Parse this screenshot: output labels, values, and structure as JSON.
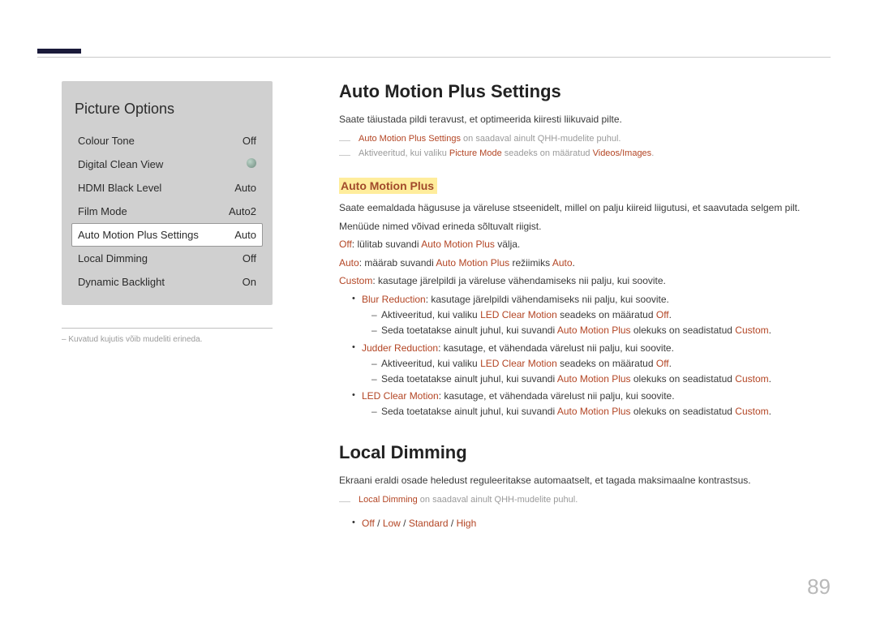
{
  "page_number": "89",
  "left": {
    "menu_title": "Picture Options",
    "rows": [
      {
        "label": "Colour Tone",
        "value": "Off"
      },
      {
        "label": "Digital Clean View",
        "value": ""
      },
      {
        "label": "HDMI Black Level",
        "value": "Auto"
      },
      {
        "label": "Film Mode",
        "value": "Auto2"
      },
      {
        "label": "Auto Motion Plus Settings",
        "value": "Auto"
      },
      {
        "label": "Local Dimming",
        "value": "Off"
      },
      {
        "label": "Dynamic Backlight",
        "value": "On"
      }
    ],
    "footnote": "Kuvatud kujutis võib mudeliti erineda."
  },
  "section1": {
    "heading": "Auto Motion Plus Settings",
    "intro": "Saate täiustada pildi teravust, et optimeerida kiiresti liikuvaid pilte.",
    "dash1_accent": "Auto Motion Plus Settings",
    "dash1_rest": " on saadaval ainult QHH-mudelite puhul.",
    "dash2_a": "Aktiveeritud, kui valiku ",
    "dash2_b": "Picture Mode",
    "dash2_c": " seadeks on määratud ",
    "dash2_d": "Videos/Images",
    "dash2_e": ".",
    "subhead": "Auto Motion Plus",
    "para1": "Saate eemaldada hägususe ja väreluse stseenidelt, millel on palju kiireid liigutusi, et saavutada selgem pilt.",
    "para2": "Menüüde nimed võivad erineda sõltuvalt riigist.",
    "off_label": "Off",
    "off_text_a": ": lülitab suvandi ",
    "off_text_b": "Auto Motion Plus",
    "off_text_c": " välja.",
    "auto_label": "Auto",
    "auto_text_a": ": määrab suvandi ",
    "auto_text_b": "Auto Motion Plus",
    "auto_text_c": " režiimiks ",
    "auto_text_d": "Auto",
    "auto_text_e": ".",
    "custom_label": "Custom",
    "custom_text": ": kasutage järelpildi ja väreluse vähendamiseks nii palju, kui soovite.",
    "blur_label": "Blur Reduction",
    "blur_text": ": kasutage järelpildi vähendamiseks nii palju, kui soovite.",
    "blur_sub1_a": "Aktiveeritud, kui valiku ",
    "blur_sub1_b": "LED Clear Motion",
    "blur_sub1_c": " seadeks on määratud ",
    "blur_sub1_d": "Off",
    "blur_sub1_e": ".",
    "blur_sub2_a": "Seda toetatakse ainult juhul, kui suvandi ",
    "blur_sub2_b": "Auto Motion Plus",
    "blur_sub2_c": " olekuks on seadistatud ",
    "blur_sub2_d": "Custom",
    "blur_sub2_e": ".",
    "judder_label": "Judder Reduction",
    "judder_text": ": kasutage, et vähendada värelust nii palju, kui soovite.",
    "judder_sub1_a": "Aktiveeritud, kui valiku ",
    "judder_sub1_b": "LED Clear Motion",
    "judder_sub1_c": " seadeks on määratud ",
    "judder_sub1_d": "Off",
    "judder_sub1_e": ".",
    "judder_sub2_a": "Seda toetatakse ainult juhul, kui suvandi ",
    "judder_sub2_b": "Auto Motion Plus",
    "judder_sub2_c": " olekuks on seadistatud ",
    "judder_sub2_d": "Custom",
    "judder_sub2_e": ".",
    "led_label": "LED Clear Motion",
    "led_text": ": kasutage, et vähendada värelust nii palju, kui soovite.",
    "led_sub_a": "Seda toetatakse ainult juhul, kui suvandi ",
    "led_sub_b": "Auto Motion Plus",
    "led_sub_c": " olekuks on seadistatud ",
    "led_sub_d": "Custom",
    "led_sub_e": "."
  },
  "section2": {
    "heading": "Local Dimming",
    "intro": "Ekraani eraldi osade heledust reguleeritakse automaatselt, et tagada maksimaalne kontrastsus.",
    "dash_accent": "Local Dimming",
    "dash_rest": " on saadaval ainult QHH-mudelite puhul.",
    "opt_off": "Off",
    "opt_low": "Low",
    "opt_standard": "Standard",
    "opt_high": "High",
    "sep": " / "
  }
}
